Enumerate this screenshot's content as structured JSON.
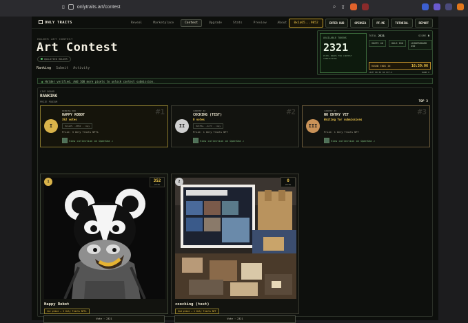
{
  "browser": {
    "url": "onlytraits.art/contest"
  },
  "nav": {
    "logo": "ONLY TRAITS",
    "links": [
      "Reveal",
      "Marketplace",
      "Contest",
      "Upgrade",
      "Stats",
      "Preview",
      "About"
    ],
    "active_link": "Contest",
    "wallet": "0x1a65...9852",
    "buttons": [
      "ENTER HUB",
      "OPENSEA",
      "PF-ME",
      "TUTORIAL",
      "REPORT"
    ]
  },
  "header": {
    "subhead": "HOLDER ART CONTEST",
    "title": "Art Contest",
    "status_badge": "QUALIFIED HOLDER",
    "tabs": [
      "Ranking",
      "Submit",
      "Activity"
    ],
    "active_tab": "Ranking"
  },
  "stats": {
    "available_label": "AVAILABLE TOKENS",
    "available_value": "2321",
    "available_caption": "PIXEL DROPS FOR CONTEST SUBMISSIONS",
    "total_label": "TOTAL",
    "total_value": "2321",
    "score_label": "SCORE",
    "score_value": "0",
    "boxes": [
      "SHOTS 46",
      "HOLD 180",
      "LEADERBOARD 450"
    ],
    "timer_label": "ROUND ENDS IN",
    "timer_value": "16:39:06",
    "footer_left": "LIVE 00:39 04 OCT-2",
    "footer_right": "RANK 0"
  },
  "notice": "Holder verified. Add 100 more pixels to unlock contest submission.",
  "ranking": {
    "sub": "LIVE BOARD",
    "title": "RANKING",
    "prizes_label": "PRIZE PODIUM",
    "top_label": "TOP 3",
    "podium": [
      {
        "place": "WINNING NOW",
        "name": "HAPPY ROBOT",
        "votes": "352 votes",
        "tag": "0x1a65...9852 · copy",
        "prize": "Prize: 3 Only Traits NFTs",
        "view": "View collection on OpenSea ↗",
        "rank": "#1",
        "medal": "I",
        "medal_color": "#d9b34a"
      },
      {
        "place": "CURRENT #2",
        "name": "COCKING (TEST)",
        "votes": "0 votes",
        "tag": "0x6f8a...2c7d · copy",
        "prize": "Prize: 1 Only Traits NFT",
        "view": "View collection on OpenSea ↗",
        "rank": "#2",
        "medal": "II",
        "medal_color": "#cfcfcf"
      },
      {
        "place": "CURRENT #3",
        "name": "NO ENTRY YET",
        "votes": "Waiting for submissions",
        "tag": "",
        "prize": "Prize: 1 Only Traits NFT",
        "view": "View collection on OpenSea ↗",
        "rank": "#3",
        "medal": "III",
        "medal_color": "#c99258"
      }
    ],
    "entries": [
      {
        "badge": "1",
        "badge_color": "#d9b34a",
        "votes": "352",
        "votes_label": "VOTES",
        "name": "Happy Robot",
        "place": "1st place — 3 Only Traits NFTs",
        "vote_label": "Vote · 2321"
      },
      {
        "badge": "2",
        "badge_color": "#cfcfcf",
        "votes": "0",
        "votes_label": "VOTES",
        "name": "coocking (test)",
        "place": "2nd place — 1 Only Traits NFT",
        "vote_label": "Vote · 2321"
      }
    ]
  }
}
